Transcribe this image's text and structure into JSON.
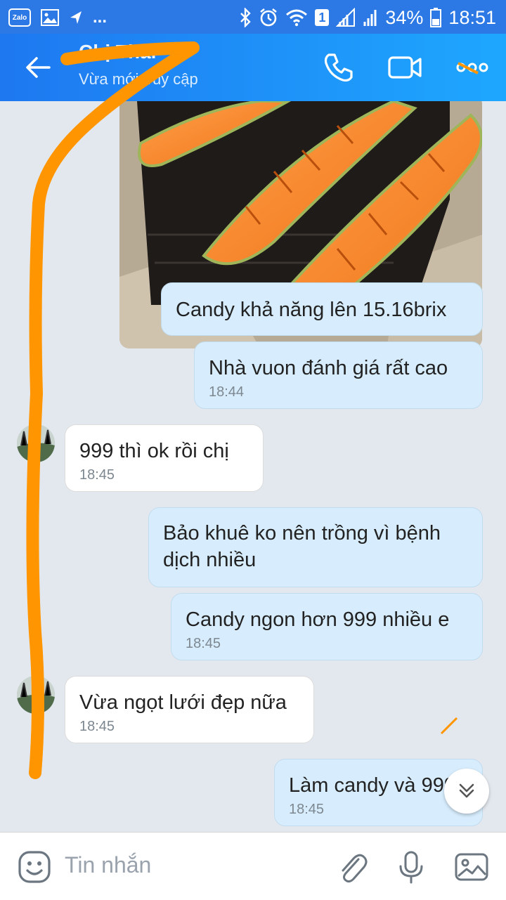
{
  "status_bar": {
    "icons": [
      "zalo-icon",
      "image-icon",
      "send-icon",
      "more-dots",
      "bluetooth-icon",
      "alarm-icon",
      "wifi-icon",
      "sim-1-icon",
      "signal-icon",
      "signal-icon",
      "battery-icon"
    ],
    "battery": "34%",
    "time": "18:51",
    "zalo_label": "Zalo",
    "sim_label": "1",
    "overflow": "..."
  },
  "header": {
    "contact_name": "Chị Thái",
    "subtitle": "Vừa mới truy cập",
    "icons": [
      "back-arrow-icon",
      "phone-icon",
      "video-call-icon",
      "more-options-icon"
    ]
  },
  "messages": [
    {
      "direction": "out",
      "text": "Candy khả năng lên 15.16brix",
      "time": ""
    },
    {
      "direction": "out",
      "text": "Nhà vuon đánh giá rất cao",
      "time": "18:44"
    },
    {
      "direction": "in",
      "text": "999 thì ok rồi chị",
      "time": "18:45"
    },
    {
      "direction": "out",
      "text": "Bảo khuê ko nên trồng vì bệnh dịch nhiều",
      "time": ""
    },
    {
      "direction": "out",
      "text": "Candy ngon hơn 999 nhiều e",
      "time": "18:45"
    },
    {
      "direction": "in",
      "text": "Vừa ngọt lưới đẹp nữa",
      "time": "18:45"
    },
    {
      "direction": "out",
      "text": "Làm candy và 999",
      "time": "18:45"
    }
  ],
  "input": {
    "placeholder": "Tin nhắn",
    "icons": [
      "emoji-icon",
      "attachment-icon",
      "microphone-icon",
      "gallery-icon"
    ]
  },
  "colors": {
    "header_start": "#1e78f0",
    "header_end": "#1ea7ff",
    "outgoing_bubble": "#d7edfd",
    "incoming_bubble": "#ffffff",
    "background": "#e3e8ee",
    "annotation": "#ff9500"
  }
}
